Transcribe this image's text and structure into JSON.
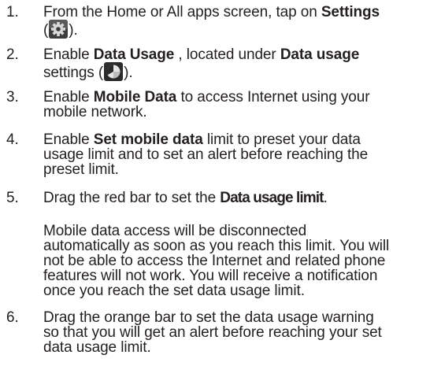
{
  "steps": [
    {
      "number": "1.",
      "lines": [
        {
          "pre": "From the Home or All apps screen, tap on ",
          "bold": "Settings",
          "post": ""
        },
        {
          "pre": "(",
          "icon": "settings-gear-icon",
          "post": ")."
        }
      ]
    },
    {
      "number": "2.",
      "lines": [
        {
          "pre": "Enable ",
          "bold": "Data Usage",
          "mid": " , located under ",
          "bold2": "Data usage",
          "post": ""
        },
        {
          "pre": "settings (",
          "icon": "data-usage-icon",
          "post": ")."
        }
      ]
    },
    {
      "number": "3.",
      "lines": [
        {
          "pre": "Enable ",
          "bold": "Mobile Data",
          "post": " to access Internet using your"
        },
        {
          "pre": "mobile network."
        }
      ]
    },
    {
      "number": "4.",
      "lines": [
        {
          "pre": "Enable ",
          "bold": "Set mobile data",
          "post": " limit to preset your data"
        },
        {
          "pre": "usage limit and to set an alert before reaching the"
        },
        {
          "pre": "preset limit."
        }
      ]
    },
    {
      "number": "5.",
      "lines": [
        {
          "pre": "Drag the red bar to set the ",
          "bold": "Data usage limit",
          "post": "."
        }
      ]
    },
    {
      "number": "6.",
      "lines": [
        {
          "pre": "Drag the orange bar to set the data usage warning"
        },
        {
          "pre": "so that you will get an alert before reaching your set"
        },
        {
          "pre": "data usage limit."
        }
      ]
    }
  ],
  "note": [
    "Mobile data access will be disconnected",
    "automatically as soon as you reach this limit. You will",
    "not be able to access the Internet and related phone",
    "features will not work. You will receive a notification",
    "once you reach the set data usage limit."
  ],
  "colors": {
    "text": "#231f20",
    "settings_icon_bg": "#4a4a4a",
    "data_usage_icon_bg": "#2b2b2b"
  }
}
